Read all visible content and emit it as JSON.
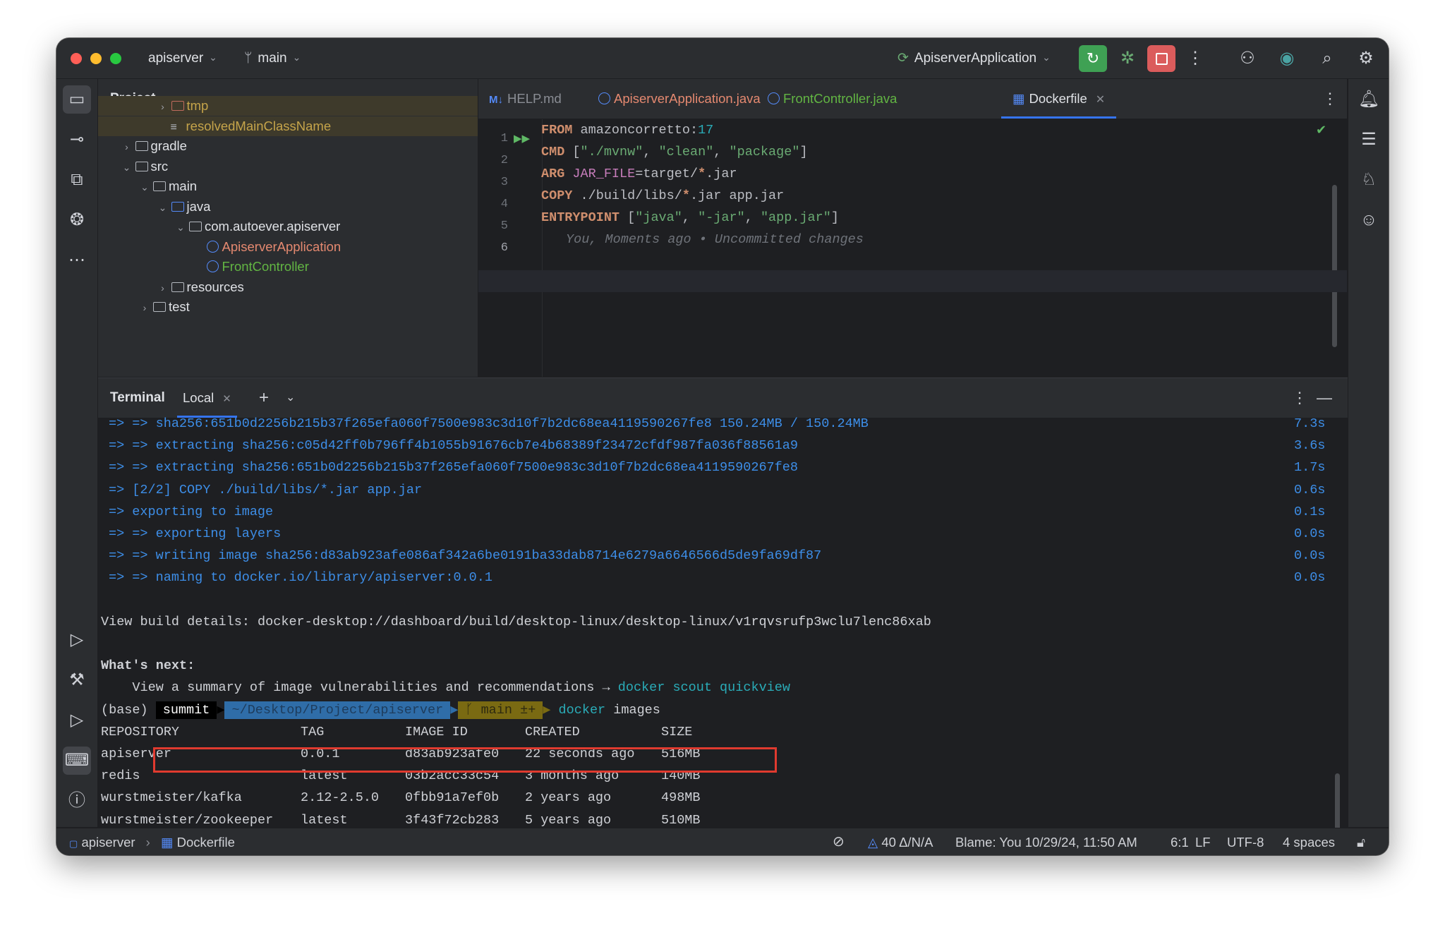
{
  "titlebar": {
    "project": "apiserver",
    "branch": "main",
    "run_config": "ApiserverApplication"
  },
  "project_panel": {
    "title": "Project",
    "tree": [
      {
        "label": "tmp",
        "depth": 3,
        "arrow": "›",
        "icon": "folder",
        "color": "#c5a44a"
      },
      {
        "label": "resolvedMainClassName",
        "depth": 3,
        "arrow": "",
        "icon": "text-file",
        "color": "#c5a44a"
      },
      {
        "label": "gradle",
        "depth": 1,
        "arrow": "›",
        "icon": "folder",
        "color": "#dfe1e5"
      },
      {
        "label": "src",
        "depth": 1,
        "arrow": "⌄",
        "icon": "folder",
        "color": "#dfe1e5"
      },
      {
        "label": "main",
        "depth": 2,
        "arrow": "⌄",
        "icon": "folder",
        "color": "#dfe1e5"
      },
      {
        "label": "java",
        "depth": 3,
        "arrow": "⌄",
        "icon": "source-folder",
        "color": "#dfe1e5"
      },
      {
        "label": "com.autoever.apiserver",
        "depth": 4,
        "arrow": "⌄",
        "icon": "package",
        "color": "#dfe1e5"
      },
      {
        "label": "ApiserverApplication",
        "depth": 5,
        "arrow": "",
        "icon": "spring-class",
        "color": "#e58970"
      },
      {
        "label": "FrontController",
        "depth": 5,
        "arrow": "",
        "icon": "class",
        "color": "#62b543"
      },
      {
        "label": "resources",
        "depth": 3,
        "arrow": "›",
        "icon": "resources-folder",
        "color": "#dfe1e5"
      },
      {
        "label": "test",
        "depth": 2,
        "arrow": "›",
        "icon": "folder",
        "color": "#dfe1e5"
      }
    ]
  },
  "editor": {
    "tabs": [
      {
        "label": "HELP.md",
        "prefix": "M↓",
        "color": "#8a8d94"
      },
      {
        "label": "ApiserverApplication.java",
        "prefix": "",
        "color": "#e58970"
      },
      {
        "label": "FrontController.java",
        "prefix": "",
        "color": "#62b543"
      },
      {
        "label": "Dockerfile",
        "prefix": "",
        "color": "#dfe1e5",
        "active": true
      }
    ],
    "line_numbers": [
      "1",
      "2",
      "3",
      "4",
      "5",
      "6"
    ],
    "code": {
      "l1_kw": "FROM",
      "l1_rest": " amazoncorretto:",
      "l1_num": "17",
      "l2_kw": "CMD",
      "l2_a": " [",
      "l2_s1": "\"./mvnw\"",
      "l2_c1": ", ",
      "l2_s2": "\"clean\"",
      "l2_c2": ", ",
      "l2_s3": "\"package\"",
      "l2_end": "]",
      "l3_kw": "ARG",
      "l3_var": " JAR_FILE",
      "l3_rest": "=target/",
      "l3_star": "*",
      "l3_end": ".jar",
      "l4_kw": "COPY",
      "l4_rest": " ./build/libs/",
      "l4_star": "*",
      "l4_end": ".jar app.jar",
      "l5_kw": "ENTRYPOINT",
      "l5_a": " [",
      "l5_s1": "\"java\"",
      "l5_c1": ", ",
      "l5_s2": "\"-jar\"",
      "l5_c2": ", ",
      "l5_s3": "\"app.jar\"",
      "l5_end": "]",
      "l6_blame": "You, Moments ago • Uncommitted changes"
    }
  },
  "terminal": {
    "title": "Terminal",
    "tab": "Local",
    "build_lines": [
      {
        "text": "=> => sha256:651b0d2256b215b37f265efa060f7500e983c3d10f7b2dc68ea4119590267fe8 150.24MB / 150.24MB",
        "time": "7.3s"
      },
      {
        "text": "=> => extracting sha256:c05d42ff0b796ff4b1055b91676cb7e4b68389f23472cfdf987fa036f88561a9",
        "time": "3.6s"
      },
      {
        "text": "=> => extracting sha256:651b0d2256b215b37f265efa060f7500e983c3d10f7b2dc68ea4119590267fe8",
        "time": "1.7s"
      },
      {
        "text": "=> [2/2] COPY ./build/libs/*.jar app.jar",
        "time": "0.6s"
      },
      {
        "text": "=> exporting to image",
        "time": "0.1s"
      },
      {
        "text": "=> => exporting layers",
        "time": "0.0s"
      },
      {
        "text": "=> => writing image sha256:d83ab923afe086af342a6be0191ba33dab8714e6279a6646566d5de9fa69df87",
        "time": "0.0s"
      },
      {
        "text": "=> => naming to docker.io/library/apiserver:0.0.1",
        "time": "0.0s"
      }
    ],
    "view_details": "View build details: docker-desktop://dashboard/build/desktop-linux/desktop-linux/v1rqvsrufp3wclu7lenc86xab",
    "whats_next": "What's next:",
    "summary_text": "    View a summary of image vulnerabilities and recommendations → ",
    "summary_cmd": "docker scout quickview",
    "prompt_env": "(base) ",
    "prompt_user": "summit",
    "prompt_path": "~/Desktop/Project/apiserver",
    "prompt_git": "ᚴ main ±+",
    "command_bin": "docker",
    "command_arg": " images",
    "table_header": [
      "REPOSITORY",
      "TAG",
      "IMAGE ID",
      "CREATED",
      "SIZE"
    ],
    "table_rows": [
      [
        "apiserver",
        "0.0.1",
        "d83ab923afe0",
        "22 seconds ago",
        "516MB"
      ],
      [
        "redis",
        "latest",
        "03b2acc33c54",
        "3 months ago",
        "140MB"
      ],
      [
        "wurstmeister/kafka",
        "2.12-2.5.0",
        "0fbb91a7ef0b",
        "2 years ago",
        "498MB"
      ],
      [
        "wurstmeister/zookeeper",
        "latest",
        "3f43f72cb283",
        "5 years ago",
        "510MB"
      ]
    ]
  },
  "statusbar": {
    "crumb_project": "apiserver",
    "crumb_file": "Dockerfile",
    "inspections": "40 Δ/N/A",
    "blame": "Blame: You 10/29/24, 11:50 AM",
    "position": "6:1",
    "line_sep": "LF",
    "encoding": "UTF-8",
    "indent": "4 spaces"
  },
  "colors": {
    "accent": "#3574f0",
    "run_green": "#3fa154",
    "stop_red": "#db5c5c",
    "highlight_box": "#e03a2f"
  }
}
